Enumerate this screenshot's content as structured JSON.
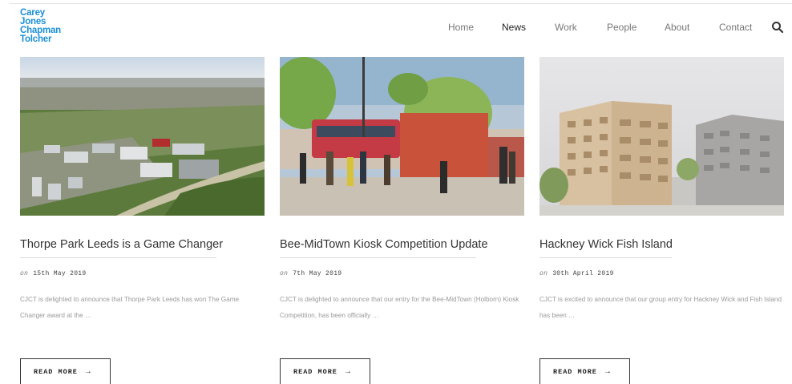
{
  "brand": {
    "line1": "Carey",
    "line2": "Jones",
    "line3": "Chapman",
    "line4": "Tolcher",
    "color": "#1a8fd6"
  },
  "nav": {
    "items": [
      {
        "label": "Home"
      },
      {
        "label": "News"
      },
      {
        "label": "Work"
      },
      {
        "label": "People"
      },
      {
        "label": "About"
      },
      {
        "label": "Contact"
      }
    ],
    "active": "News",
    "search_icon": "search-icon"
  },
  "posts": [
    {
      "title": "Thorpe Park Leeds is a Game Changer",
      "on": "on",
      "date": "15th May 2019",
      "excerpt": "CJCT is delighted to announce that Thorpe Park Leeds has won The Game Changer award at the …",
      "cta": "READ MORE",
      "arrow": "→",
      "image_icon": "aerial-photo-image"
    },
    {
      "title": "Bee-MidTown Kiosk Competition Update",
      "on": "on",
      "date": "7th May 2019",
      "excerpt": "CJCT is delighted to announce that our entry for the Bee-MidTown (Holborn) Kiosk Competition, has been officially …",
      "cta": "READ MORE",
      "arrow": "→",
      "image_icon": "kiosk-illustration-image"
    },
    {
      "title": "Hackney Wick Fish Island",
      "on": "on",
      "date": "30th April 2019",
      "excerpt": "CJCT is excited to announce that our group entry for Hackney Wick and Fish Island has been …",
      "cta": "READ MORE",
      "arrow": "→",
      "image_icon": "building-render-image"
    }
  ]
}
